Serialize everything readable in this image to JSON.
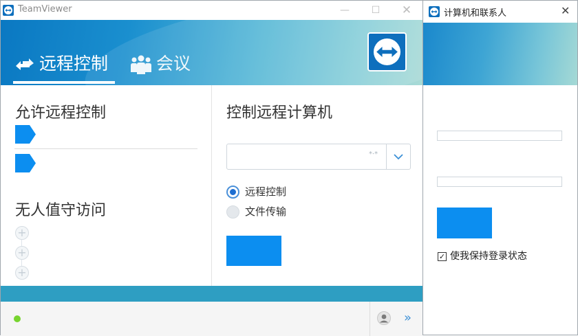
{
  "main_window": {
    "title": "TeamViewer",
    "tabs": [
      {
        "label": "远程控制",
        "icon": "arrows-icon"
      },
      {
        "label": "会议",
        "icon": "people-icon"
      }
    ],
    "left": {
      "allow_heading": "允许远程控制",
      "unattended_heading": "无人值守访问"
    },
    "right": {
      "heading": "控制远程计算机",
      "partner_id_value": "",
      "options": [
        {
          "label": "远程控制",
          "selected": true
        },
        {
          "label": "文件传输",
          "selected": false
        }
      ],
      "connect_button_label": ""
    },
    "status": {
      "color": "#77d42f"
    }
  },
  "contacts_window": {
    "title": "计算机和联系人",
    "email_value": "",
    "password_value": "",
    "signin_button_label": "",
    "keep_signed_in_label": "使我保持登录状态",
    "keep_signed_in_checked": true
  },
  "colors": {
    "accent_blue": "#0c8ef0",
    "status_bar": "#2e9ec2"
  }
}
